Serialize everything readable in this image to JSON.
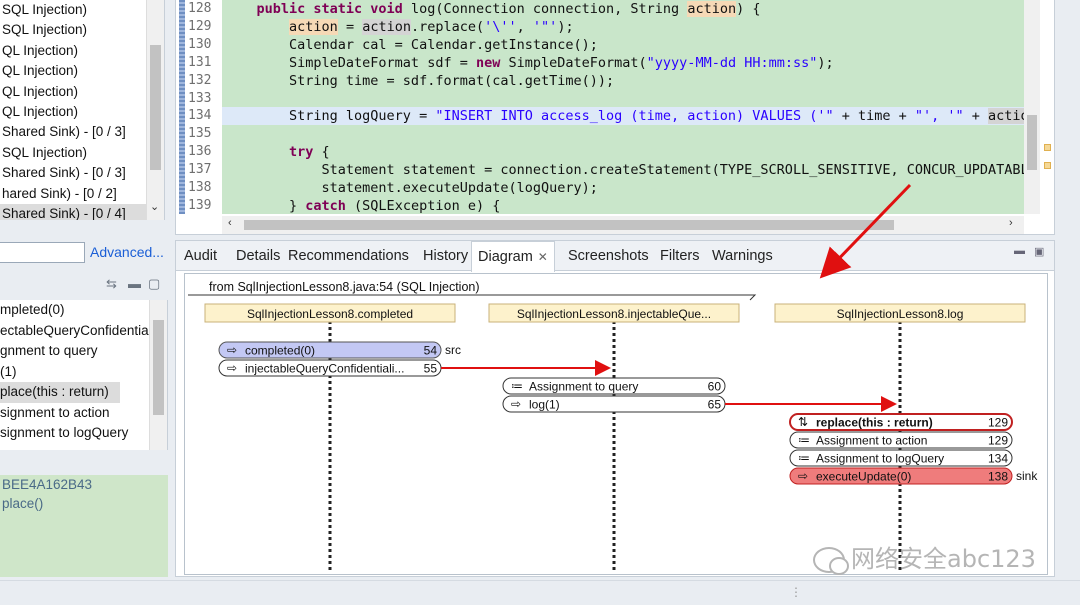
{
  "tree_top": {
    "rows": [
      "SQL Injection)",
      "SQL Injection)",
      "QL Injection)",
      "QL Injection)",
      "QL Injection)",
      "QL Injection)",
      "Shared Sink) - [0 / 3]",
      "SQL Injection)",
      "Shared Sink) - [0 / 3]",
      "hared Sink) - [0 / 2]",
      "Shared Sink) - [0 / 4]"
    ],
    "selected_index": 10
  },
  "search": {
    "value": "",
    "advanced_label": "Advanced..."
  },
  "trace_list": {
    "rows": [
      "mpleted(0)",
      "ectableQueryConfidentia",
      "gnment to query",
      "(1)",
      "place(this : return)",
      "signment to action",
      "signment to logQuery"
    ],
    "selected_index": 4
  },
  "detail_box": {
    "rows": [
      "BEE4A162B43",
      "place()"
    ]
  },
  "editor": {
    "lines": [
      {
        "n": "128",
        "tokens": [
          [
            "",
            "    "
          ],
          [
            "kw",
            "public static void"
          ],
          [
            "",
            " log(Connection connection, String "
          ],
          [
            "hv",
            "action"
          ],
          [
            "",
            ") {"
          ]
        ]
      },
      {
        "n": "129",
        "tokens": [
          [
            "",
            "        "
          ],
          [
            "hv",
            "action"
          ],
          [
            "",
            " = "
          ],
          [
            "hg",
            "action"
          ],
          [
            "",
            ".replace("
          ],
          [
            "st",
            "'\\''"
          ],
          [
            "",
            ", "
          ],
          [
            "st",
            "'\"'"
          ],
          [
            "",
            ");"
          ]
        ]
      },
      {
        "n": "130",
        "tokens": [
          [
            "",
            "        Calendar cal = Calendar.getInstance();"
          ]
        ]
      },
      {
        "n": "131",
        "tokens": [
          [
            "",
            "        SimpleDateFormat sdf = "
          ],
          [
            "kw",
            "new"
          ],
          [
            "",
            " SimpleDateFormat("
          ],
          [
            "st",
            "\"yyyy-MM-dd HH:mm:ss\""
          ],
          [
            "",
            ");"
          ]
        ]
      },
      {
        "n": "132",
        "tokens": [
          [
            "",
            "        String time = sdf.format(cal.getTime());"
          ]
        ]
      },
      {
        "n": "133",
        "tokens": [
          [
            "",
            ""
          ]
        ]
      },
      {
        "n": "134",
        "tokens": [
          [
            "",
            "        String logQuery = "
          ],
          [
            "st",
            "\"INSERT INTO access_log (time, action) VALUES ('\""
          ],
          [
            "",
            " + time + "
          ],
          [
            "st",
            "\"', '\""
          ],
          [
            "",
            " + "
          ],
          [
            "hg",
            "action"
          ]
        ]
      },
      {
        "n": "135",
        "tokens": [
          [
            "",
            ""
          ]
        ]
      },
      {
        "n": "136",
        "tokens": [
          [
            "",
            "        "
          ],
          [
            "kw",
            "try"
          ],
          [
            "",
            " {"
          ]
        ]
      },
      {
        "n": "137",
        "tokens": [
          [
            "",
            "            Statement statement = connection.createStatement(TYPE_SCROLL_SENSITIVE, CONCUR_UPDATABLE"
          ]
        ]
      },
      {
        "n": "138",
        "tokens": [
          [
            "",
            "            statement.executeUpdate(logQuery);"
          ]
        ]
      },
      {
        "n": "139",
        "tokens": [
          [
            "",
            "        } "
          ],
          [
            "kw",
            "catch"
          ],
          [
            "",
            " (SQLException e) {"
          ]
        ]
      }
    ],
    "highlight_line": "134"
  },
  "tabs": [
    {
      "label": "Audit"
    },
    {
      "label": "Details"
    },
    {
      "label": "Recommendations"
    },
    {
      "label": "History"
    },
    {
      "label": "Diagram",
      "active": true
    },
    {
      "label": "Screenshots"
    },
    {
      "label": "Filters"
    },
    {
      "label": "Warnings"
    }
  ],
  "diagram": {
    "frame_label": "from SqlInjectionLesson8.java:54 (SQL Injection)",
    "lifelines": [
      {
        "label": "SqlInjectionLesson8.completed"
      },
      {
        "label": "SqlInjectionLesson8.injectableQue..."
      },
      {
        "label": "SqlInjectionLesson8.log"
      }
    ],
    "nodes": [
      {
        "label": "completed(0)",
        "line": "54",
        "tag": "src",
        "style": "src"
      },
      {
        "label": "injectableQueryConfidentiali...",
        "line": "55",
        "tag": "",
        "style": "plain"
      },
      {
        "label": "Assignment to query",
        "line": "60",
        "tag": "",
        "style": "plain"
      },
      {
        "label": "log(1)",
        "line": "65",
        "tag": "",
        "style": "plain"
      },
      {
        "label": "replace(this : return)",
        "line": "129",
        "tag": "",
        "style": "selected"
      },
      {
        "label": "Assignment to action",
        "line": "129",
        "tag": "",
        "style": "plain"
      },
      {
        "label": "Assignment to logQuery",
        "line": "134",
        "tag": "",
        "style": "plain"
      },
      {
        "label": "executeUpdate(0)",
        "line": "138",
        "tag": "sink",
        "style": "sink"
      }
    ]
  },
  "watermark": "网络安全abc123",
  "colors": {
    "code_bg": "#c9e6ca",
    "keyword": "#7f0055",
    "string": "#2a00ff",
    "sink_fill": "#ef7c7c",
    "src_fill": "#c3c8f4",
    "arrow": "#e01010",
    "lifeline_header": "#fdf2cc"
  }
}
